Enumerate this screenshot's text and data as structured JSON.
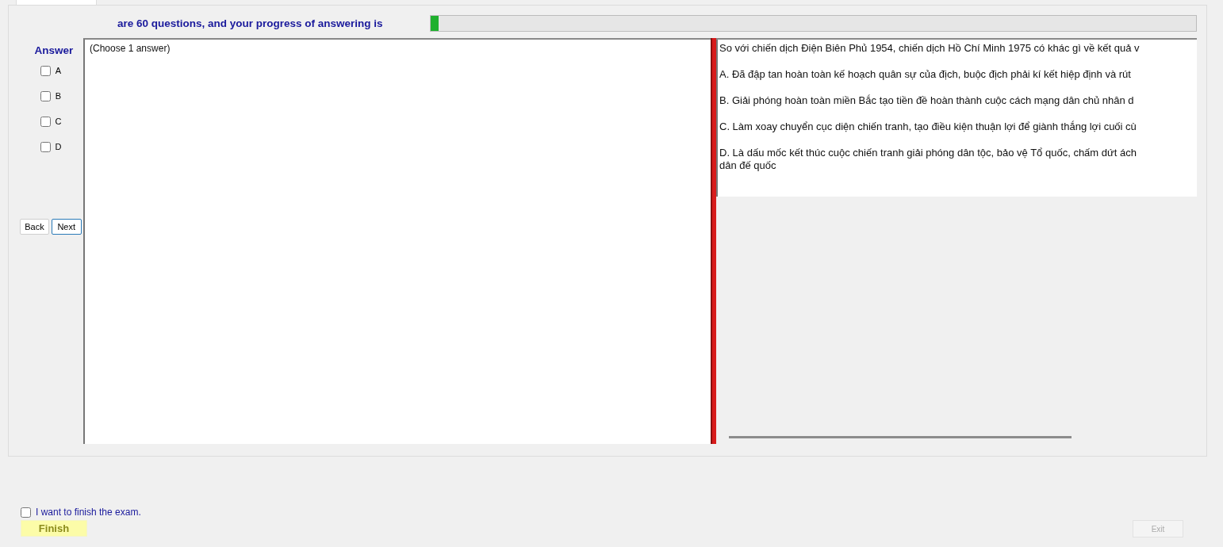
{
  "header": {
    "text": "are 60 questions, and your progress of answering is",
    "progress": {
      "level": 0.01
    }
  },
  "answer_panel": {
    "title": "Answer",
    "options": [
      {
        "label": "A",
        "checked": false
      },
      {
        "label": "B",
        "checked": false
      },
      {
        "label": "C",
        "checked": false
      },
      {
        "label": "D",
        "checked": false
      }
    ],
    "buttons": [
      {
        "label": "Back",
        "focused": false
      },
      {
        "label": "Next",
        "focused": true
      }
    ]
  },
  "instruction": "(Choose 1 answer)",
  "question": {
    "stem": "So với chiến dịch Điện Biên Phủ 1954, chiến dịch Hồ Chí Minh 1975 có khác gì về kết quả v",
    "options": [
      [
        "A.  Đã đập tan hoàn toàn kế hoạch quân sự của địch, buộc địch phải kí kết hiệp định và rút"
      ],
      [
        "B.  Giải phóng hoàn toàn miền Bắc tạo tiền đề hoàn thành cuộc cách mạng dân chủ nhân d"
      ],
      [
        "C.  Làm xoay chuyển cục diện chiến tranh, tạo điều kiện thuận lợi để giành thắng lợi cuối cù"
      ],
      [
        "D.  Là dấu mốc kết thúc cuộc chiến tranh giải phóng dân tộc, bảo vệ Tổ quốc, chấm dứt ách",
        "dân đế quốc"
      ]
    ]
  },
  "finish": {
    "confirm_label": "I want to finish the exam.",
    "confirm_checked": false,
    "finish_button": "Finish",
    "exit_button": "Exit",
    "exit_disabled": true
  }
}
